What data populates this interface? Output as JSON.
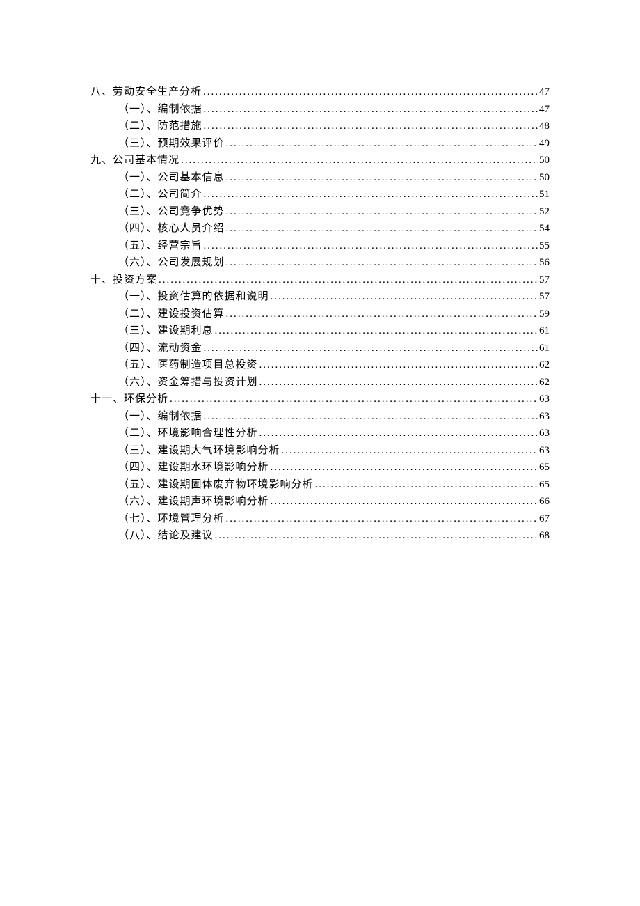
{
  "toc": [
    {
      "level": 1,
      "label": "八、劳动安全生产分析",
      "page": "47"
    },
    {
      "level": 2,
      "label": "（一）、编制依据",
      "page": "47"
    },
    {
      "level": 2,
      "label": "（二）、防范措施",
      "page": "48"
    },
    {
      "level": 2,
      "label": "（三）、预期效果评价",
      "page": "49"
    },
    {
      "level": 1,
      "label": "九、公司基本情况",
      "page": "50"
    },
    {
      "level": 2,
      "label": "（一）、公司基本信息",
      "page": "50"
    },
    {
      "level": 2,
      "label": "（二）、公司简介",
      "page": "51"
    },
    {
      "level": 2,
      "label": "（三）、公司竞争优势",
      "page": "52"
    },
    {
      "level": 2,
      "label": "（四）、核心人员介绍",
      "page": "54"
    },
    {
      "level": 2,
      "label": "（五）、经营宗旨",
      "page": "55"
    },
    {
      "level": 2,
      "label": "（六）、公司发展规划",
      "page": "56"
    },
    {
      "level": 1,
      "label": "十、投资方案",
      "page": "57"
    },
    {
      "level": 2,
      "label": "（一）、投资估算的依据和说明",
      "page": "57"
    },
    {
      "level": 2,
      "label": "（二）、建设投资估算",
      "page": "59"
    },
    {
      "level": 2,
      "label": "（三）、建设期利息",
      "page": "61"
    },
    {
      "level": 2,
      "label": "（四）、流动资金",
      "page": "61"
    },
    {
      "level": 2,
      "label": "（五）、医药制造项目总投资",
      "page": "62"
    },
    {
      "level": 2,
      "label": "（六）、资金筹措与投资计划",
      "page": "62"
    },
    {
      "level": 1,
      "label": "十一、环保分析",
      "page": "63"
    },
    {
      "level": 2,
      "label": "（一）、编制依据",
      "page": "63"
    },
    {
      "level": 2,
      "label": "（二）、环境影响合理性分析",
      "page": "63"
    },
    {
      "level": 2,
      "label": "（三）、建设期大气环境影响分析",
      "page": "63"
    },
    {
      "level": 2,
      "label": "（四）、建设期水环境影响分析",
      "page": "65"
    },
    {
      "level": 2,
      "label": "（五）、建设期固体废弃物环境影响分析",
      "page": "65"
    },
    {
      "level": 2,
      "label": "（六）、建设期声环境影响分析",
      "page": "66"
    },
    {
      "level": 2,
      "label": "（七）、环境管理分析",
      "page": "67"
    },
    {
      "level": 2,
      "label": "（八）、结论及建议",
      "page": "68"
    }
  ]
}
